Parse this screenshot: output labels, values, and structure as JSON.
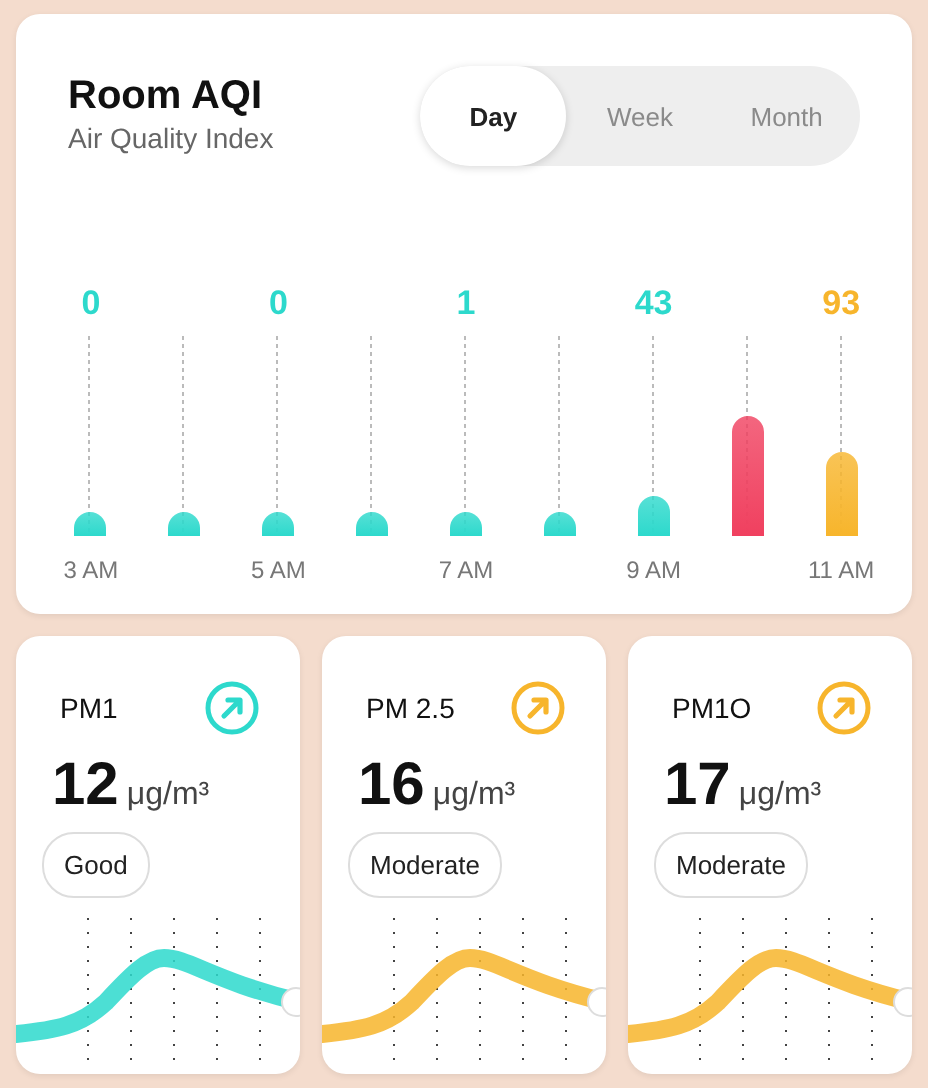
{
  "aqi_card": {
    "title": "Room AQI",
    "subtitle": "Air Quality Index",
    "tabs": [
      {
        "label": "Day",
        "selected": true
      },
      {
        "label": "Week",
        "selected": false
      },
      {
        "label": "Month",
        "selected": false
      }
    ],
    "columns": [
      {
        "value": "0",
        "time": "3 AM",
        "level": 0.12,
        "color": "#2dd9cc"
      },
      {
        "level": 0.12,
        "color": "#2dd9cc"
      },
      {
        "value": "0",
        "time": "5 AM",
        "level": 0.12,
        "color": "#2dd9cc"
      },
      {
        "level": 0.12,
        "color": "#2dd9cc"
      },
      {
        "value": "1",
        "time": "7 AM",
        "level": 0.12,
        "color": "#2dd9cc"
      },
      {
        "level": 0.12,
        "color": "#2dd9cc"
      },
      {
        "value": "43",
        "time": "9 AM",
        "level": 0.2,
        "color": "#2dd9cc"
      },
      {
        "level": 0.6,
        "color": "#f0405f"
      },
      {
        "value": "93",
        "time": "11 AM",
        "level": 0.42,
        "color": "#f7b52c"
      }
    ]
  },
  "pm_cards": [
    {
      "name": "PM1",
      "value": "12",
      "unit": "μg/m³",
      "status": "Good",
      "color": "#2dd9cc"
    },
    {
      "name": "PM 2.5",
      "value": "16",
      "unit": "μg/m³",
      "status": "Moderate",
      "color": "#f7b52c"
    },
    {
      "name": "PM1O",
      "value": "17",
      "unit": "μg/m³",
      "status": "Moderate",
      "color": "#f7b52c"
    }
  ]
}
